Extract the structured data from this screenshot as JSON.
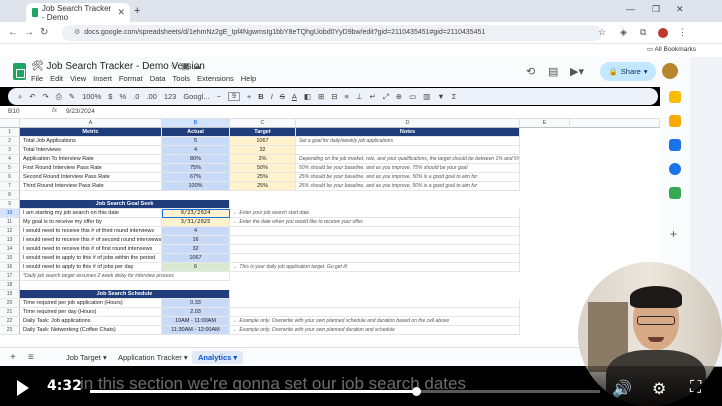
{
  "browser": {
    "tab_title": "Job Search Tracker - Demo",
    "url": "docs.google.com/spreadsheets/d/1ehmNz2gE_Ipf4NgwmsIg1bbY8eTQhgUobd0YyD9bw/edit?gid=2110435451#gid=2110435451",
    "bookmarks_label": "All Bookmarks"
  },
  "doc": {
    "title": "🛠 Job Search Tracker - Demo Version",
    "menus": [
      "File",
      "Edit",
      "View",
      "Insert",
      "Format",
      "Data",
      "Tools",
      "Extensions",
      "Help"
    ],
    "share_label": "Share"
  },
  "toolbar": {
    "zoom": "100%",
    "currency": "$",
    "percent": "%",
    "decimals_dec": ".0",
    "decimals_inc": ".00",
    "number_format": "123",
    "font": "Googl...",
    "font_size": "9",
    "bold": "B",
    "italic": "I",
    "strike": "S",
    "text_color": "A"
  },
  "formula_bar": {
    "cell_ref": "B10",
    "fx": "fx",
    "value": "9/23/2024"
  },
  "columns": [
    "A",
    "B",
    "C",
    "D",
    "E"
  ],
  "metrics_table": {
    "headers": [
      "Metric",
      "Actual",
      "Target",
      "Notes"
    ],
    "rows": [
      {
        "n": "2",
        "metric": "Total Job Applications",
        "actual": "5",
        "target": "1067",
        "note": "Set a goal for daily/weekly job applications"
      },
      {
        "n": "3",
        "metric": "Total Interviews",
        "actual": "4",
        "target": "32",
        "note": ""
      },
      {
        "n": "4",
        "metric": "Application To Interview Rate",
        "actual": "80%",
        "target": "3%",
        "note": "Depending on the job market, role, and your qualifications, the target should be between 1% and 5%"
      },
      {
        "n": "5",
        "metric": "First Round Interview Pass Rate",
        "actual": "75%",
        "target": "50%",
        "note": "50% should be your baseline, and as you improve, 75% should be your goal"
      },
      {
        "n": "6",
        "metric": "Second Round Interview Pass Rate",
        "actual": "67%",
        "target": "25%",
        "note": "25% should be your baseline, and as you improve, 50% is a good goal to aim for"
      },
      {
        "n": "7",
        "metric": "Third Round Interview Pass Rate",
        "actual": "100%",
        "target": "25%",
        "note": "25% should be your baseline, and as you improve, 50% is a good goal to aim for"
      }
    ]
  },
  "goal_seek": {
    "title": "Job Search Goal Seek",
    "rows": [
      {
        "n": "10",
        "label": "I am starting my job search on this date",
        "value": "9/23/2024",
        "note": "← Enter your job search start date"
      },
      {
        "n": "11",
        "label": "My goal is to receive my offer by",
        "value": "3/31/2025",
        "note": "← Enter the date when you would like to receive your offer."
      },
      {
        "n": "12",
        "label": "I would need to receive this # of third round interviews",
        "value": "4",
        "note": ""
      },
      {
        "n": "13",
        "label": "I would need to receive this # of second round interviews",
        "value": "16",
        "note": ""
      },
      {
        "n": "14",
        "label": "I would need to receive this # of first round interviews",
        "value": "32",
        "note": ""
      },
      {
        "n": "15",
        "label": "I would need to apply to this # of jobs within the period",
        "value": "1067",
        "note": ""
      },
      {
        "n": "16",
        "label": "I would need to apply to this # of jobs per day",
        "value": "6",
        "note": "← This is your daily job application target. Go get it!"
      }
    ],
    "footnote_n": "17",
    "footnote": "*Daily job search target assumes 2 week delay for interview process"
  },
  "schedule": {
    "title": "Job Search Schedule",
    "rows": [
      {
        "n": "20",
        "label": "Time required per job application (Hours)",
        "value": "0.33",
        "note": ""
      },
      {
        "n": "21",
        "label": "Time required per day (Hours)",
        "value": "2.03",
        "note": ""
      },
      {
        "n": "22",
        "label": "Daily Task: Job applications",
        "value": "10AM - 11:00AM",
        "note": "← Example only. Overwrite with your own planned schedule and duration based on the cell above"
      },
      {
        "n": "23",
        "label": "Daily Task: Networking (Coffee Chats)",
        "value": "11:30AM - 12:00AM",
        "note": "← Example only. Overwrite with your own planned duration and schedule"
      }
    ]
  },
  "row_numbers": {
    "r1": "1",
    "r8": "8",
    "r9": "9",
    "r18": "18",
    "r19": "19"
  },
  "sheet_tabs": [
    {
      "label": "Job Target ▾",
      "active": false
    },
    {
      "label": "Application Tracker ▾",
      "active": false
    },
    {
      "label": "Analytics ▾",
      "active": true
    }
  ],
  "video": {
    "time": "4:32",
    "progress": 0.64,
    "caption": "in this section we're gonna set our job search dates"
  }
}
